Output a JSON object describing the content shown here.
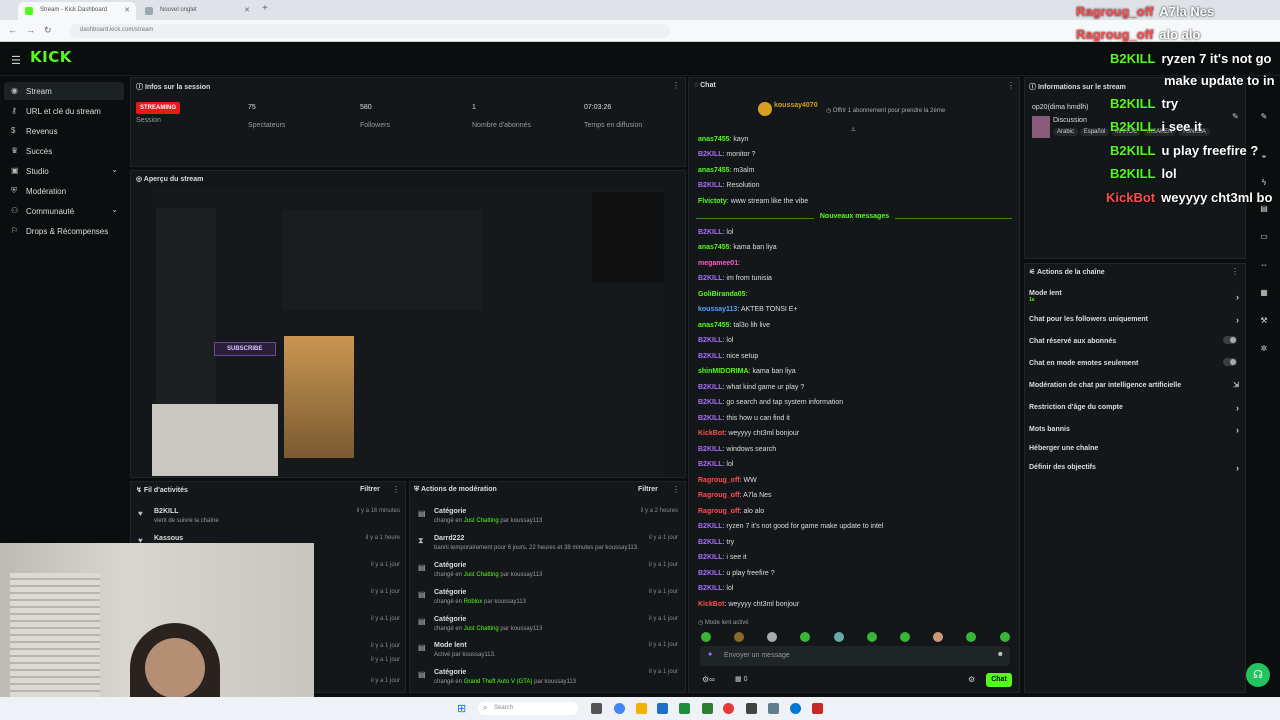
{
  "browser": {
    "tabs": [
      {
        "label": "Stream - Kick Dashboard"
      },
      {
        "label": "Nouvel onglet"
      }
    ],
    "url": "dashboard.kick.com/stream"
  },
  "app": {
    "logo": "KICK"
  },
  "sidebar": {
    "items": [
      {
        "label": "Stream",
        "icon": "stream-icon"
      },
      {
        "label": "URL et clé du stream",
        "icon": "key-icon"
      },
      {
        "label": "Revenus",
        "icon": "money-icon"
      },
      {
        "label": "Succès",
        "icon": "trophy-icon"
      },
      {
        "label": "Studio",
        "icon": "studio-icon"
      },
      {
        "label": "Modération",
        "icon": "shield-icon"
      },
      {
        "label": "Communauté",
        "icon": "people-icon"
      },
      {
        "label": "Drops & Récompenses",
        "icon": "gift-icon"
      }
    ]
  },
  "session": {
    "title": "Infos sur la session",
    "live_badge": "STREAMING",
    "stats": [
      {
        "label": "Session",
        "value": ""
      },
      {
        "label": "Spectateurs",
        "value": "75"
      },
      {
        "label": "Followers",
        "value": "580"
      },
      {
        "label": "Nombre d'abonnés",
        "value": "1"
      },
      {
        "label": "Temps en diffusion",
        "value": "07:03:26"
      }
    ]
  },
  "preview": {
    "title": "Aperçu du stream",
    "subscribe_text": "SUBSCRIBE"
  },
  "activity": {
    "title": "Fil d'activités",
    "filter": "Filtrer",
    "rows": [
      {
        "name": "B2KILL",
        "sub": "vient de suivre la chaîne",
        "time": "il y a 16 minutes"
      },
      {
        "name": "Kassous",
        "sub": "",
        "time": "il y a 1 heure"
      },
      {
        "name": "",
        "sub": "",
        "time": "il y a 1 jour"
      },
      {
        "name": "",
        "sub": "",
        "time": "il y a 1 jour"
      },
      {
        "name": "",
        "sub": "",
        "time": "il y a 1 jour"
      },
      {
        "name": "",
        "sub": "",
        "time": "il y a 1 jour"
      },
      {
        "name": "",
        "sub": "",
        "time": "il y a 1 jour"
      },
      {
        "name": "",
        "sub": "",
        "time": "il y a 1 jour"
      }
    ]
  },
  "moderation": {
    "title": "Actions de modération",
    "filter": "Filtrer",
    "rows": [
      {
        "name": "Catégorie",
        "pre": "changé en ",
        "green": "Just Chatting",
        "post": " par koussay113",
        "time": "il y a 2 heures"
      },
      {
        "name": "Darrd222",
        "pre": "banni temporairement pour 6 jours, 22 heures et 38 minutes par koussay113.",
        "green": "",
        "post": "",
        "time": "il y a 1 jour"
      },
      {
        "name": "Catégorie",
        "pre": "changé en ",
        "green": "Just Chatting",
        "post": " par koussay113",
        "time": "il y a 1 jour"
      },
      {
        "name": "Catégorie",
        "pre": "changé en ",
        "green": "Roblox",
        "post": " par koussay113",
        "time": "il y a 1 jour"
      },
      {
        "name": "Catégorie",
        "pre": "changé en ",
        "green": "Just Chatting",
        "post": " par koussay113",
        "time": "il y a 1 jour"
      },
      {
        "name": "Mode lent",
        "pre": "Activé par koussay113.",
        "green": "",
        "post": "",
        "time": "il y a 1 jour"
      },
      {
        "name": "Catégorie",
        "pre": "changé en ",
        "green": "Grand Theft Auto V (GTA)",
        "post": " par koussay113",
        "time": "il y a 1 jour"
      }
    ]
  },
  "chat": {
    "title": "Chat",
    "pinned_user": "koussay4070",
    "pinned_text": "Offrir 1 abonnement pour prendre la 2ème",
    "new_messages": "Nouveaux messages",
    "messages": [
      {
        "user": "anas7455",
        "color": "#53fc18",
        "text": "kayn"
      },
      {
        "user": "B2KILL",
        "color": "#a970ff",
        "text": "monitor ?"
      },
      {
        "user": "anas7455",
        "color": "#53fc18",
        "text": "m3alm"
      },
      {
        "user": "B2KILL",
        "color": "#a970ff",
        "text": "Resolution"
      },
      {
        "user": "Flvictoty",
        "color": "#53fc18",
        "text": "www stream like the vibe"
      },
      {
        "user": "B2KILL",
        "color": "#a970ff",
        "text": "lol"
      },
      {
        "user": "anas7455",
        "color": "#53fc18",
        "text": "kama ban liya"
      },
      {
        "user": "megamee01",
        "color": "#ff5cd1",
        "text": ""
      },
      {
        "user": "B2KILL",
        "color": "#a970ff",
        "text": "im from tunisia"
      },
      {
        "user": "GoliBiranda05",
        "color": "#53fc18",
        "text": ""
      },
      {
        "user": "koussay113",
        "color": "#4ea6ff",
        "text": "AKTEB TONSI E+"
      },
      {
        "user": "anas7455",
        "color": "#53fc18",
        "text": "tal3o lih live"
      },
      {
        "user": "B2KILL",
        "color": "#a970ff",
        "text": "lol"
      },
      {
        "user": "B2KILL",
        "color": "#a970ff",
        "text": "nice setup"
      },
      {
        "user": "shinMIDORIMA",
        "color": "#53fc18",
        "text": "kama ban liya"
      },
      {
        "user": "B2KILL",
        "color": "#a970ff",
        "text": "what kind game ur play ?"
      },
      {
        "user": "B2KILL",
        "color": "#a970ff",
        "text": "go search and tap system information"
      },
      {
        "user": "B2KILL",
        "color": "#a970ff",
        "text": "this how u can find it"
      },
      {
        "user": "KickBot",
        "color": "#ff4d4d",
        "text": "weyyyy cht3ml bonjour"
      },
      {
        "user": "B2KILL",
        "color": "#a970ff",
        "text": "windows search"
      },
      {
        "user": "B2KILL",
        "color": "#a970ff",
        "text": "lol"
      },
      {
        "user": "Ragroug_off",
        "color": "#ff4d4d",
        "text": "WW"
      },
      {
        "user": "Ragroug_off",
        "color": "#ff4d4d",
        "text": "A7la Nes"
      },
      {
        "user": "Ragroug_off",
        "color": "#ff4d4d",
        "text": "alo alo"
      },
      {
        "user": "B2KILL",
        "color": "#a970ff",
        "text": "ryzen 7 it's not good for game make update to intel"
      },
      {
        "user": "B2KILL",
        "color": "#a970ff",
        "text": "try"
      },
      {
        "user": "B2KILL",
        "color": "#a970ff",
        "text": "i see it"
      },
      {
        "user": "B2KILL",
        "color": "#a970ff",
        "text": "u play freefire ?"
      },
      {
        "user": "B2KILL",
        "color": "#a970ff",
        "text": "lol"
      },
      {
        "user": "KickBot",
        "color": "#ff4d4d",
        "text": "weyyyy cht3ml bonjour"
      }
    ],
    "slow_mode": "Mode lent activé",
    "input_placeholder": "Envoyer un message",
    "send_label": "Chat",
    "count": "0"
  },
  "stream_info": {
    "title": "Informations sur le stream",
    "stream_title": "op20(dima hmdlh)",
    "category": "Discussion",
    "tags": [
      "Arabic",
      "Español",
      "MAROC",
      "MSAKEN",
      "TUNISIA"
    ]
  },
  "channel_actions": {
    "title": "Actions de la chaîne",
    "items": [
      {
        "label": "Mode lent",
        "sub": "1s",
        "control": "arrow"
      },
      {
        "label": "Chat pour les followers uniquement",
        "control": "arrow"
      },
      {
        "label": "Chat réservé aux abonnés",
        "control": "toggle"
      },
      {
        "label": "Chat en mode emotes seulement",
        "control": "toggle"
      },
      {
        "label": "Modération de chat par intelligence artificielle",
        "control": "icon"
      },
      {
        "label": "Restriction d'âge du compte",
        "control": "arrow"
      },
      {
        "label": "Mots bannis",
        "control": "arrow"
      },
      {
        "label": "Héberger une chaîne",
        "control": "none"
      },
      {
        "label": "Définir des objectifs",
        "control": "arrow"
      }
    ]
  },
  "overlay_chat": [
    {
      "user": "Ragroug_off",
      "user_color": "#ff4d4d",
      "text": "A7la Nes"
    },
    {
      "user": "Ragroug_off",
      "user_color": "#ff4d4d",
      "text": "alo alo"
    },
    {
      "user": "B2KILL",
      "user_color": "#53fc18",
      "text": "ryzen 7 it's not go"
    },
    {
      "user": "",
      "user_color": "#53fc18",
      "text": "make update to in"
    },
    {
      "user": "B2KILL",
      "user_color": "#53fc18",
      "text": "try"
    },
    {
      "user": "B2KILL",
      "user_color": "#53fc18",
      "text": "i see it"
    },
    {
      "user": "B2KILL",
      "user_color": "#53fc18",
      "text": "u play freefire ?"
    },
    {
      "user": "B2KILL",
      "user_color": "#53fc18",
      "text": "lol"
    },
    {
      "user": "KickBot",
      "user_color": "#ff4d4d",
      "text": "weyyyy cht3ml bo"
    }
  ],
  "taskbar": {
    "search_placeholder": "Search"
  },
  "colors": {
    "accent": "#53fc18",
    "background": "#0b0e0f",
    "panel": "#141719",
    "live": "#e91916"
  }
}
